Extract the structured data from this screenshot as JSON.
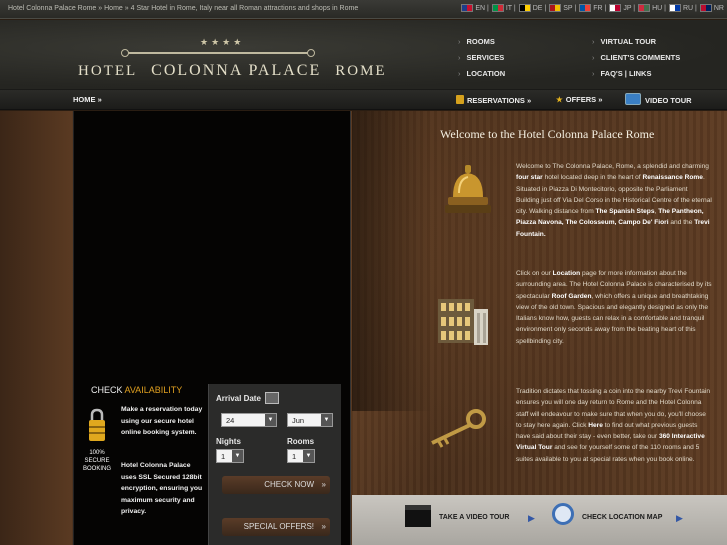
{
  "topbar": {
    "crumbs": [
      "Hotel Colonna Palace Rome",
      "Home",
      "4 Star Hotel in Rome, Italy near all Roman attractions and shops in Rome"
    ],
    "sep": " » ",
    "languages": [
      {
        "code": "EN",
        "colors": [
          "#1f3d8a",
          "#c8102e"
        ]
      },
      {
        "code": "IT",
        "colors": [
          "#009246",
          "#ce2b37"
        ]
      },
      {
        "code": "DE",
        "colors": [
          "#000000",
          "#ffce00"
        ]
      },
      {
        "code": "SP",
        "colors": [
          "#aa151b",
          "#f1bf00"
        ]
      },
      {
        "code": "FR",
        "colors": [
          "#0055a4",
          "#ef4135"
        ]
      },
      {
        "code": "JP",
        "colors": [
          "#ffffff",
          "#bc002d"
        ]
      },
      {
        "code": "HU",
        "colors": [
          "#cd2a3e",
          "#436f4d"
        ]
      },
      {
        "code": "RU",
        "colors": [
          "#ffffff",
          "#0039a6"
        ]
      },
      {
        "code": "NR",
        "colors": [
          "#ba0c2f",
          "#00205b"
        ]
      }
    ]
  },
  "header": {
    "stars": "★★★★",
    "logo_left": "HOTEL",
    "logo_mid": "COLONNA PALACE",
    "logo_right": "ROME",
    "nav": [
      "ROOMS",
      "VIRTUAL TOUR",
      "SERVICES",
      "CLIENT'S COMMENTS",
      "LOCATION",
      "FAQ'S | LINKS"
    ]
  },
  "subnav": {
    "home": "HOME »",
    "reservations": "RESERVATIONS »",
    "offers": "OFFERS »",
    "video_tour": "VIDEO TOUR"
  },
  "content": {
    "title": "Welcome to the Hotel Colonna Palace Rome",
    "p1": "Welcome to The Colonna Palace, Rome, a splendid and charming <b>four star</b> hotel located deep in the heart of <b>Renaissance Rome</b>. Situated in Piazza Di Montecitorio, opposite the Parliament Building just off Via Del Corso in the Historical Centre of the eternal city. Walking distance from <b>The Spanish Steps</b>, <b>The Pantheon, Piazza Navona, The Colosseum, Campo De' Fiori</b> and the <b>Trevi Fountain.</b>",
    "p2": "Click on our <b>Location</b> page for more information about the surrounding area. The Hotel Colonna Palace is characterised by its spectacular <b>Roof Garden</b>, which offers a unique and breathtaking view of the old town. Spacious and elegantly designed as only the Italians know how, guests can relax in a comfortable and tranquil environment only seconds away from the beating heart of this spellbinding city.",
    "p3": "Tradition dictates that tossing a coin into the nearby Trevi Fountain ensures you will one day return to Rome and the Hotel Colonna staff will endeavour to make sure that when you do, you'll choose to stay here again. Click <b>Here</b> to find out what previous guests have said about their stay - even better, take our <b>360 Interactive Virtual Tour</b> and see for yourself some of the 110 rooms and 5 suites available to you at special rates when you book online."
  },
  "bottom": {
    "video": "TAKE A VIDEO TOUR",
    "map": "CHECK LOCATION MAP"
  },
  "booking": {
    "title_a": "CHECK ",
    "title_b": "AVAILABILITY",
    "secure": "100% SECURE BOOKING",
    "text1": "Make a reservation today using our secure hotel online booking system.",
    "text2": "Hotel Colonna Palace uses SSL Secured 128bit encryption, ensuring you maximum security and privacy.",
    "arrival_label": "Arrival Date",
    "day": "24",
    "month": "Jun",
    "nights_label": "Nights",
    "nights": "1",
    "rooms_label": "Rooms",
    "rooms": "1",
    "check_now": "CHECK NOW",
    "special_offers": "SPECIAL OFFERS!"
  }
}
